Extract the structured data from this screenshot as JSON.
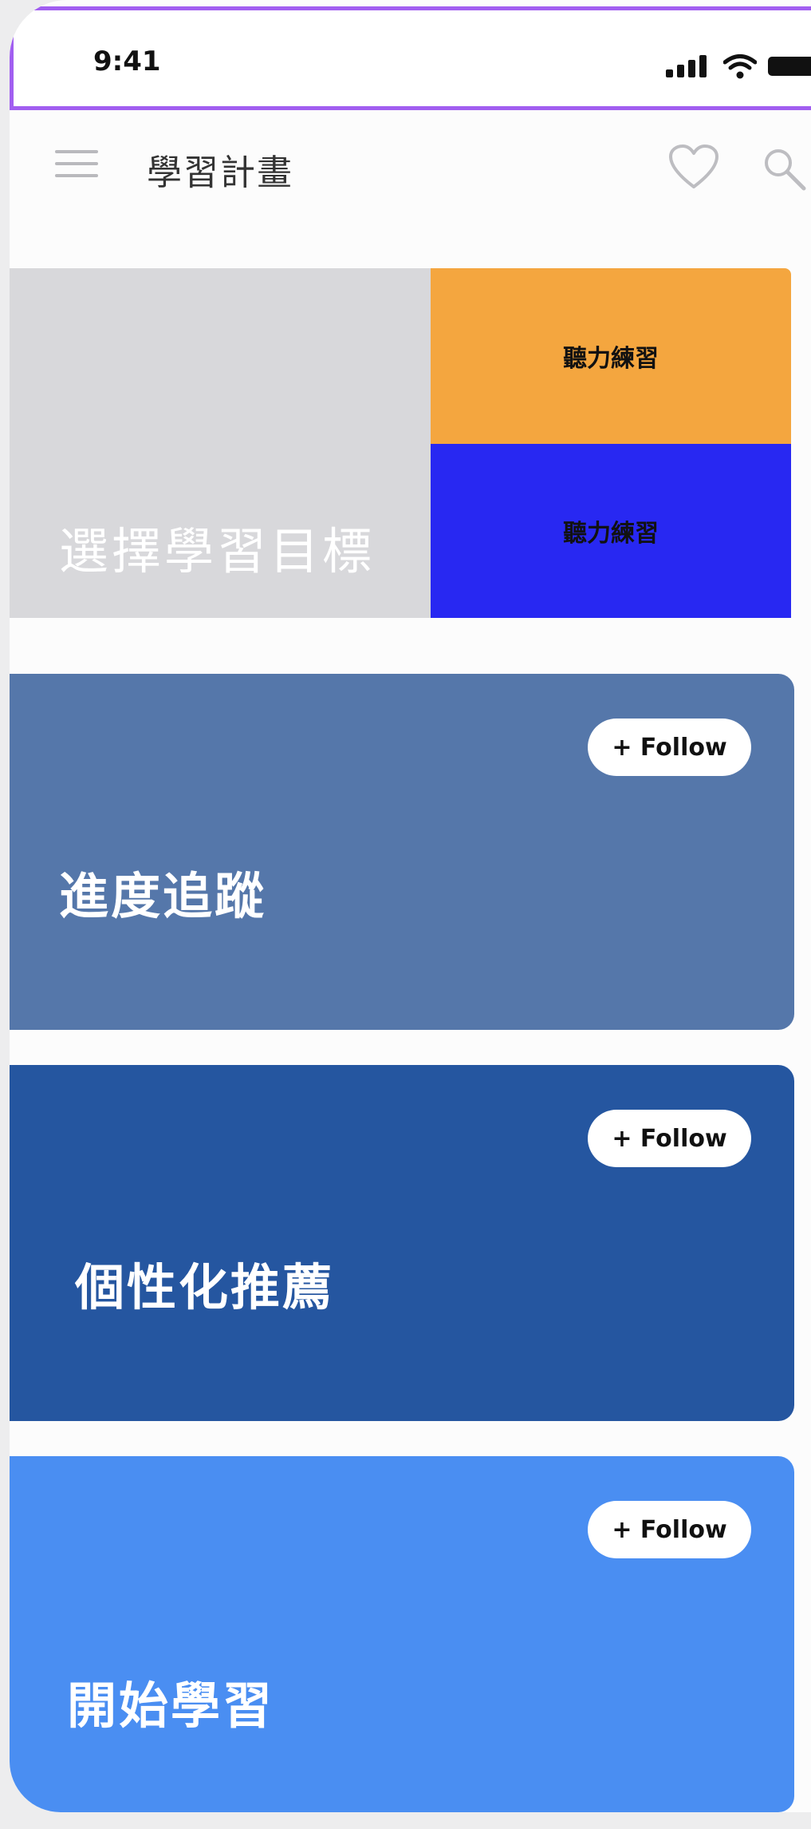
{
  "status_bar": {
    "time": "9:41",
    "icons": [
      "signal-icon",
      "wifi-icon",
      "battery-icon"
    ]
  },
  "nav": {
    "title": "學習計畫",
    "icons": [
      "menu-icon",
      "heart-icon",
      "search-icon"
    ]
  },
  "hero": {
    "title": "選擇學習目標",
    "tiles": [
      {
        "label": "聽力練習",
        "color": "#f4a63f"
      },
      {
        "label": "聽力練習",
        "color": "#2828f2"
      }
    ]
  },
  "cards": [
    {
      "title": "進度追蹤",
      "follow_label": "+ Follow",
      "color": "#5577aa"
    },
    {
      "title": "個性化推薦",
      "follow_label": "+ Follow",
      "color": "#2556a0"
    },
    {
      "title": "開始學習",
      "follow_label": "+ Follow",
      "color": "#4a8ef2"
    }
  ],
  "colors": {
    "status_bar_outline": "#a15ef0",
    "hero_background": "#d8d8db"
  }
}
